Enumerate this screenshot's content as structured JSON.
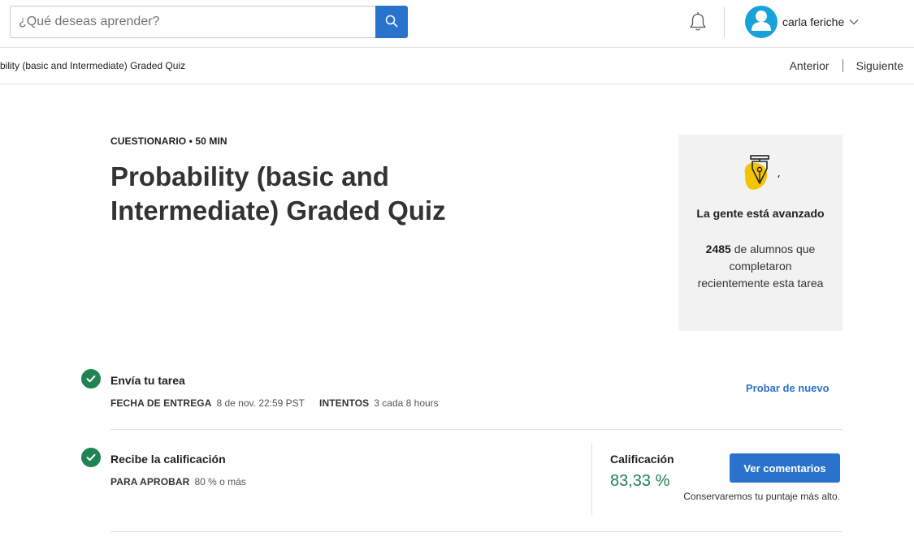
{
  "search": {
    "placeholder": "¿Qué deseas aprender?"
  },
  "user": {
    "name": "carla feriche"
  },
  "breadcrumb": "bility (basic and Intermediate) Graded Quiz",
  "nav": {
    "prev": "Anterior",
    "next": "Siguiente"
  },
  "header": {
    "eyebrow": "CUESTIONARIO • 50 MIN",
    "title": "Probability (basic and Intermediate) Graded Quiz"
  },
  "card": {
    "heading": "La gente está avanzado",
    "count": "2485",
    "text": " de alumnos que completaron recientemente esta tarea"
  },
  "submit": {
    "title": "Envía tu tarea",
    "due_label": "FECHA DE ENTREGA",
    "due_value": "8 de nov. 22:59 PST",
    "attempts_label": "INTENTOS",
    "attempts_value": "3 cada 8 hours",
    "retry_label": "Probar de nuevo"
  },
  "grade": {
    "title": "Recibe la calificación",
    "pass_label": "PARA APROBAR",
    "pass_value": "80 % o más",
    "label": "Calificación",
    "value": "83,33 %",
    "feedback_label": "Ver comentarios",
    "note": "Conservaremos tu puntaje más alto."
  },
  "colors": {
    "accent": "#2a73cc",
    "success": "#1f8354",
    "avatar": "#17a2d9",
    "card_bg": "#f2f2f2",
    "icon_yellow": "#f5c400"
  },
  "icons": [
    "search-icon",
    "bell-icon",
    "user-icon",
    "chevron-down-icon",
    "pen-nib-icon",
    "check-icon"
  ]
}
